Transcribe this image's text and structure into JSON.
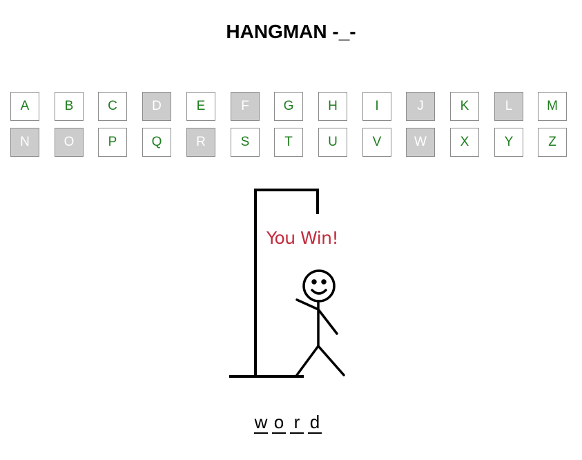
{
  "header": {
    "title": "HANGMAN -_-"
  },
  "keyboard": {
    "rows": [
      [
        {
          "letter": "A",
          "used": false
        },
        {
          "letter": "B",
          "used": false
        },
        {
          "letter": "C",
          "used": false
        },
        {
          "letter": "D",
          "used": true
        },
        {
          "letter": "E",
          "used": false
        },
        {
          "letter": "F",
          "used": true
        },
        {
          "letter": "G",
          "used": false
        },
        {
          "letter": "H",
          "used": false
        },
        {
          "letter": "I",
          "used": false
        },
        {
          "letter": "J",
          "used": true
        },
        {
          "letter": "K",
          "used": false
        },
        {
          "letter": "L",
          "used": true
        },
        {
          "letter": "M",
          "used": false
        }
      ],
      [
        {
          "letter": "N",
          "used": true
        },
        {
          "letter": "O",
          "used": true
        },
        {
          "letter": "P",
          "used": false
        },
        {
          "letter": "Q",
          "used": false
        },
        {
          "letter": "R",
          "used": true
        },
        {
          "letter": "S",
          "used": false
        },
        {
          "letter": "T",
          "used": false
        },
        {
          "letter": "U",
          "used": false
        },
        {
          "letter": "V",
          "used": false
        },
        {
          "letter": "W",
          "used": true
        },
        {
          "letter": "X",
          "used": false
        },
        {
          "letter": "Y",
          "used": false
        },
        {
          "letter": "Z",
          "used": false
        }
      ]
    ]
  },
  "status": {
    "message": "You Win!"
  },
  "word": {
    "letters": [
      "w",
      "o",
      "r",
      "d"
    ]
  },
  "colors": {
    "available_letter": "#1e7d1e",
    "used_bg": "#cccccc",
    "win_text": "#c32a3b"
  }
}
